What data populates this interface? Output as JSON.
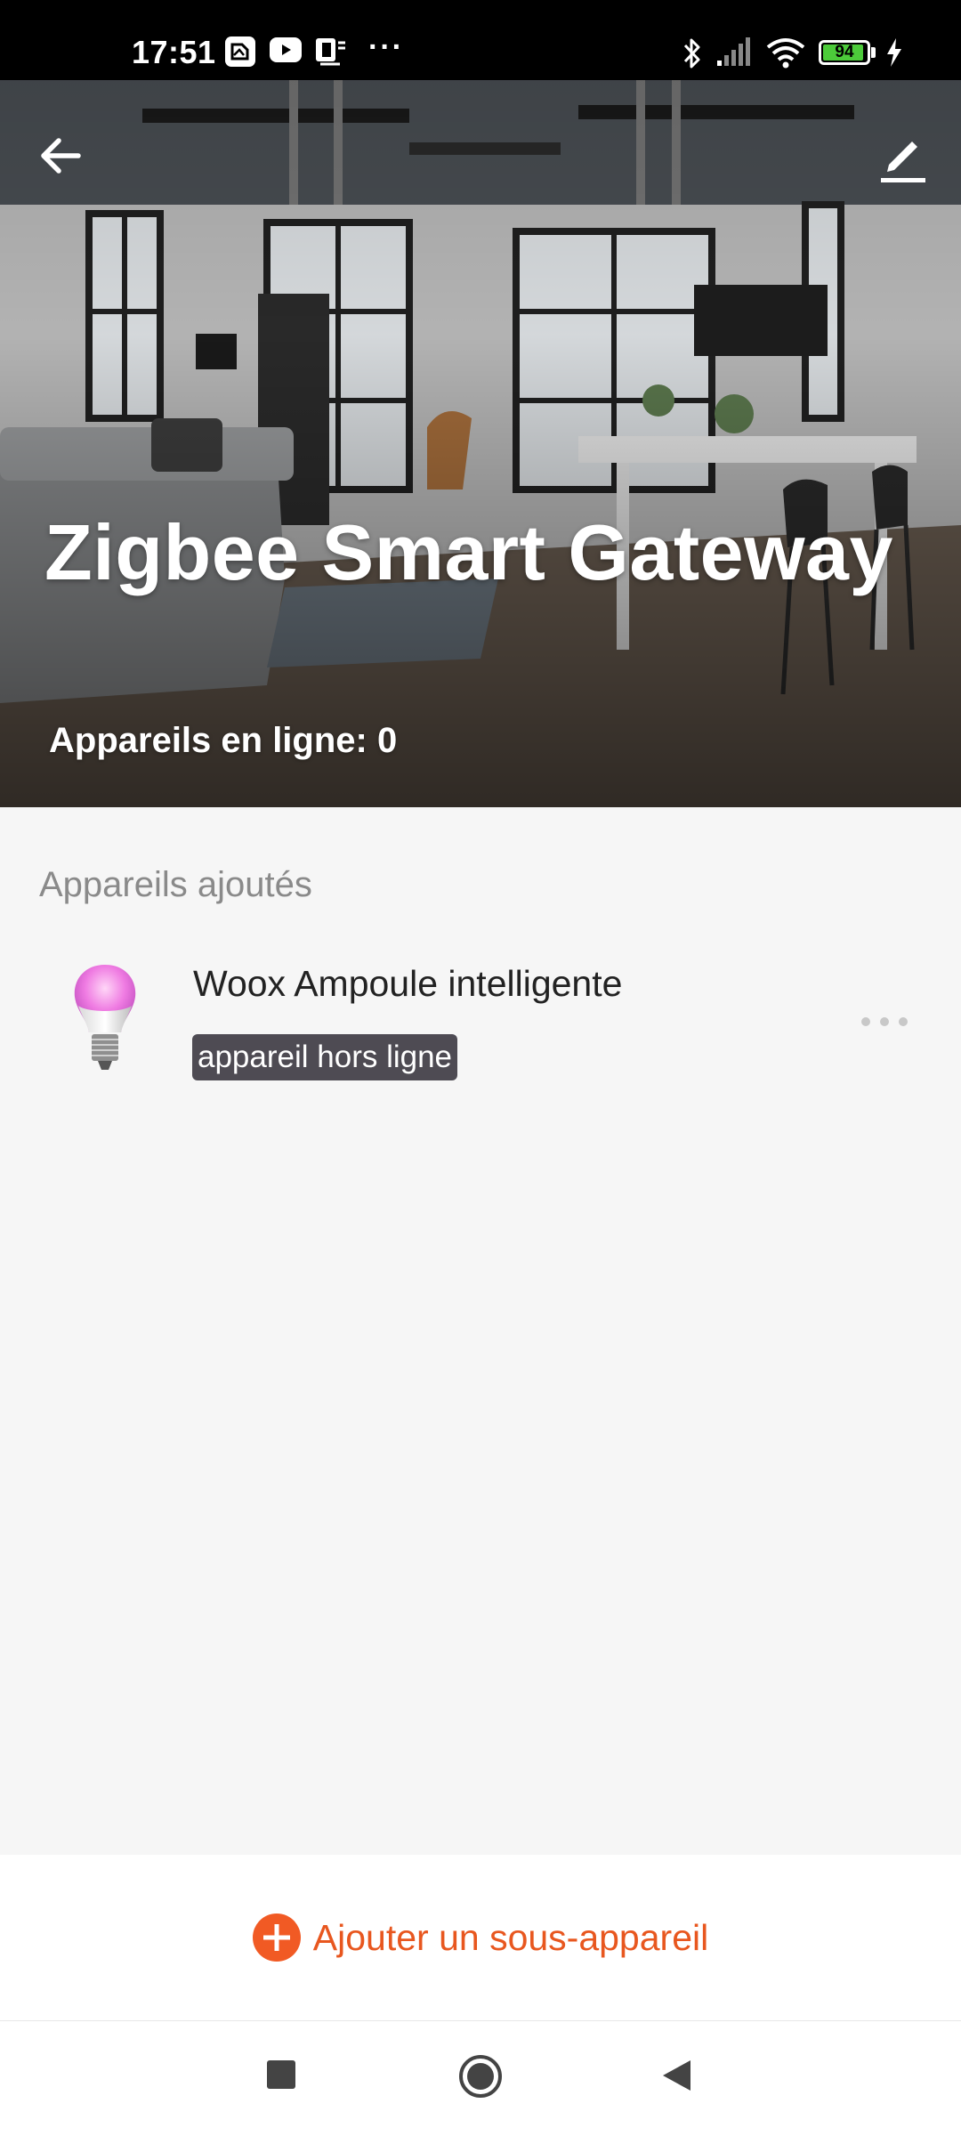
{
  "status_bar": {
    "time": "17:51",
    "battery_level": 94,
    "battery_text": "94",
    "more_indicator": "···",
    "icons": [
      "gallery-icon",
      "youtube-icon",
      "phone-sync-icon",
      "bluetooth-icon",
      "signal-icon",
      "wifi-icon",
      "battery-icon",
      "charging-icon"
    ]
  },
  "header": {
    "title": "Zigbee Smart Gateway",
    "online_count_label": "Appareils en ligne: 0",
    "back_icon": "arrow-left-icon",
    "edit_icon": "pencil-icon"
  },
  "devices_section": {
    "label": "Appareils ajoutés",
    "items": [
      {
        "name": "Woox Ampoule intelligente",
        "status": "appareil hors ligne",
        "icon": "bulb-icon"
      }
    ]
  },
  "add_button": {
    "label": "Ajouter un sous-appareil",
    "icon": "plus-circle-icon",
    "color": "#f15a24"
  },
  "nav_bar": {
    "icons": [
      "recents-square-icon",
      "home-circle-icon",
      "back-triangle-icon"
    ]
  }
}
